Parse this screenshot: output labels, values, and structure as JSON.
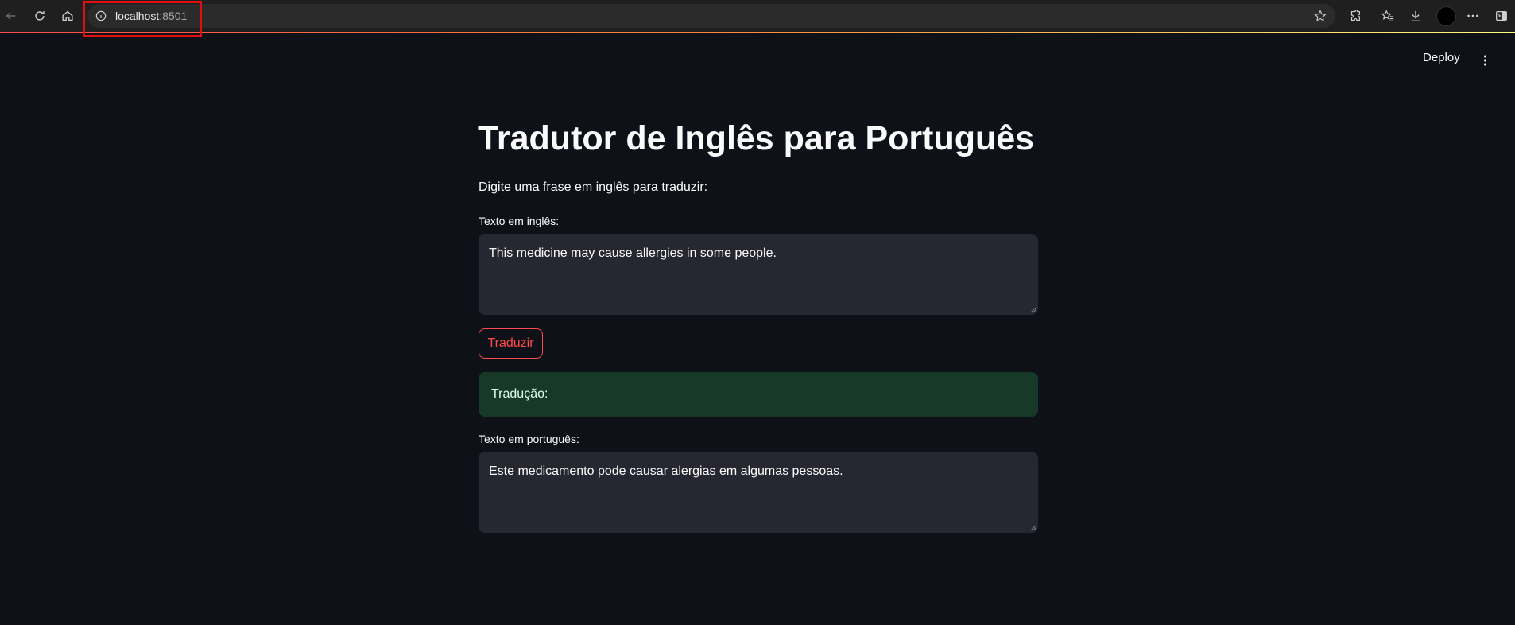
{
  "browser": {
    "url_host": "localhost",
    "url_port": ":8501"
  },
  "header": {
    "deploy_label": "Deploy"
  },
  "main": {
    "title": "Tradutor de Inglês para Português",
    "prompt": "Digite uma frase em inglês para traduzir:",
    "input_label": "Texto em inglês:",
    "input_value": "This medicine may cause allergies in some people.",
    "button_label": "Traduzir",
    "success_message": "Tradução:",
    "output_label": "Texto em português:",
    "output_value": "Este medicamento pode causar alergias em algumas pessoas."
  },
  "colors": {
    "background": "#0e1117",
    "accent": "#ff4b4b",
    "success_bg": "#173928",
    "input_bg": "#262730"
  },
  "icons": [
    "back-icon",
    "reload-icon",
    "home-icon",
    "info-icon",
    "star-icon",
    "extensions-icon",
    "favorites-icon",
    "download-icon",
    "more-icon",
    "sidebar-icon",
    "kebab-menu-icon"
  ]
}
